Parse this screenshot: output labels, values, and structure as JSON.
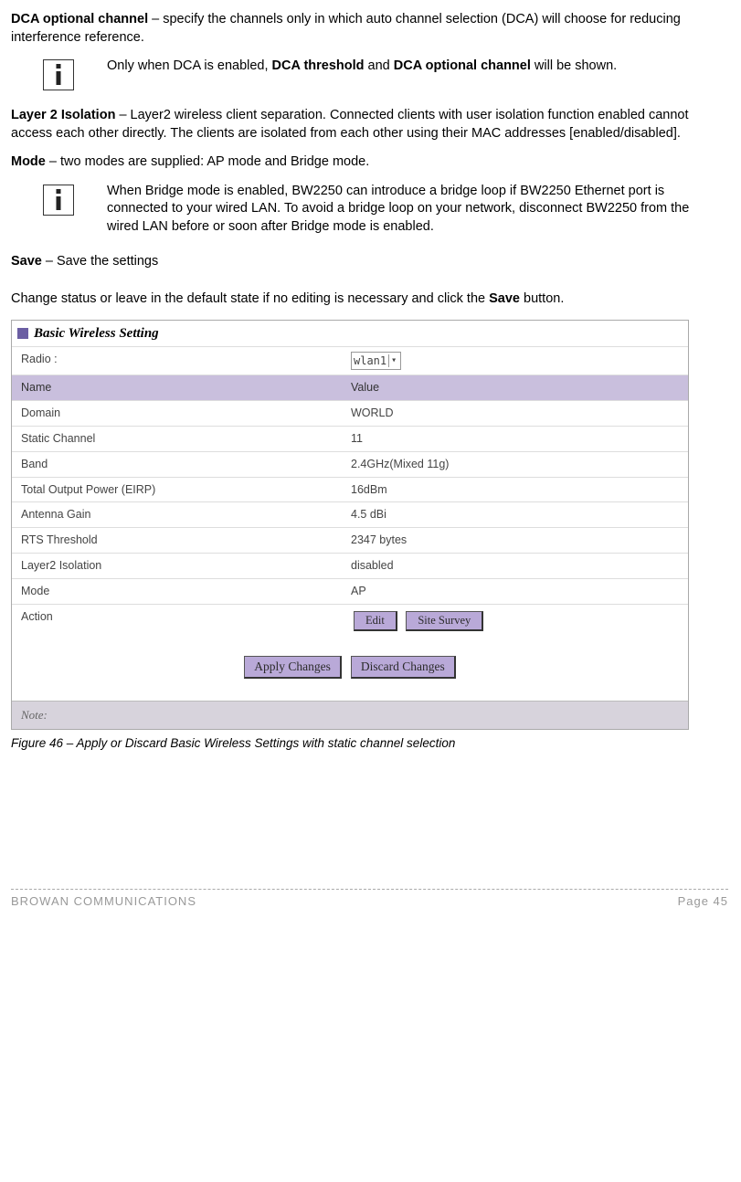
{
  "p_dca_opt": {
    "b": "DCA optional channel",
    "t": " – specify the channels only in which auto channel selection (DCA) will choose for reducing interference reference."
  },
  "info1": {
    "pre": "Only when DCA is enabled, ",
    "b1": "DCA threshold",
    "mid": " and ",
    "b2": "DCA optional channel",
    "post": " will be shown."
  },
  "p_layer2": {
    "b": "Layer 2 Isolation",
    "t": " – Layer2 wireless client separation. Connected clients with user isolation function enabled cannot access each other directly. The clients are isolated from each other using their MAC addresses [enabled/disabled]."
  },
  "p_mode": {
    "b": "Mode",
    "t": " – two modes are supplied: AP mode and Bridge mode."
  },
  "info2": {
    "t": "When Bridge mode is enabled, BW2250 can introduce a bridge loop if BW2250 Ethernet port is connected to your wired LAN. To avoid a bridge loop on your network, disconnect BW2250 from the wired LAN before or soon after Bridge mode is enabled."
  },
  "p_save": {
    "b": "Save",
    "t": " – Save the settings"
  },
  "p_change": {
    "pre": "Change status or leave in the default state if no editing is necessary and click the ",
    "b": "Save",
    "post": " button."
  },
  "panel_title": "Basic Wireless Setting",
  "radio_label": "Radio :",
  "radio_value": "wlan1",
  "hdr_name": "Name",
  "hdr_value": "Value",
  "rows": [
    {
      "n": "Domain",
      "v": "WORLD"
    },
    {
      "n": "Static Channel",
      "v": "11"
    },
    {
      "n": "Band",
      "v": "2.4GHz(Mixed 11g)"
    },
    {
      "n": "Total Output Power (EIRP)",
      "v": "16dBm"
    },
    {
      "n": "Antenna Gain",
      "v": "4.5 dBi"
    },
    {
      "n": "RTS Threshold",
      "v": "2347 bytes"
    },
    {
      "n": "Layer2 Isolation",
      "v": "disabled"
    },
    {
      "n": "Mode",
      "v": "AP"
    }
  ],
  "action_label": "Action",
  "btn_edit": "Edit",
  "btn_site": "Site Survey",
  "btn_apply": "Apply Changes",
  "btn_discard": "Discard Changes",
  "note_label": "Note:",
  "caption": "Figure 46 – Apply or Discard Basic Wireless Settings with static channel selection",
  "footer_left": "BROWAN COMMUNICATIONS",
  "footer_right": "Page 45",
  "chart_data": {
    "type": "table",
    "title": "Basic Wireless Setting",
    "columns": [
      "Name",
      "Value"
    ],
    "rows": [
      [
        "Radio",
        "wlan1"
      ],
      [
        "Domain",
        "WORLD"
      ],
      [
        "Static Channel",
        "11"
      ],
      [
        "Band",
        "2.4GHz(Mixed 11g)"
      ],
      [
        "Total Output Power (EIRP)",
        "16dBm"
      ],
      [
        "Antenna Gain",
        "4.5 dBi"
      ],
      [
        "RTS Threshold",
        "2347 bytes"
      ],
      [
        "Layer2 Isolation",
        "disabled"
      ],
      [
        "Mode",
        "AP"
      ],
      [
        "Action",
        "Edit / Site Survey"
      ]
    ]
  }
}
